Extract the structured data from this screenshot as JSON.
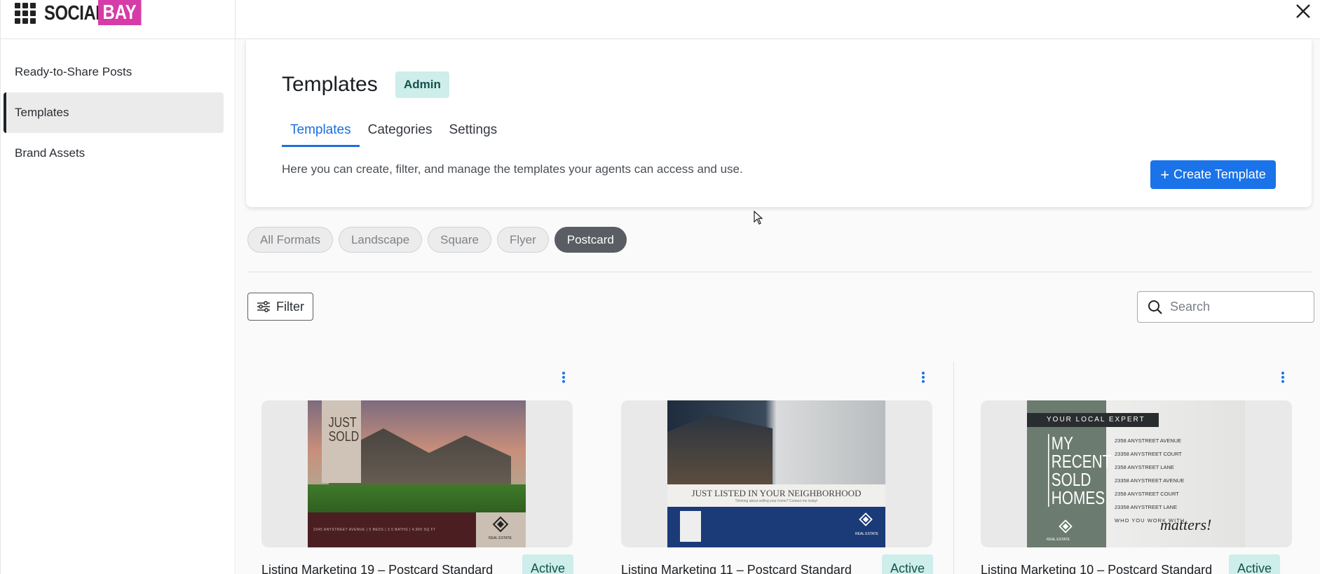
{
  "logo": {
    "part1": "SOCIAL",
    "part2": "BAY"
  },
  "sidebar": {
    "items": [
      {
        "label": "Ready-to-Share Posts"
      },
      {
        "label": "Templates"
      },
      {
        "label": "Brand Assets"
      }
    ]
  },
  "header": {
    "title": "Templates",
    "badge": "Admin",
    "tabs": [
      {
        "label": "Templates"
      },
      {
        "label": "Categories"
      },
      {
        "label": "Settings"
      }
    ],
    "description": "Here you can create, filter, and manage the templates your agents can access and use.",
    "create_label": "Create Template"
  },
  "formats": [
    "All Formats",
    "Landscape",
    "Square",
    "Flyer",
    "Postcard"
  ],
  "active_format": "Postcard",
  "filter_label": "Filter",
  "search": {
    "placeholder": "Search",
    "value": ""
  },
  "cards": [
    {
      "title": "Listing Marketing 19 – Postcard Standard",
      "status": "Active",
      "art": {
        "headline": "JUST SOLD",
        "address": "2345 ANYSTREET AVENUE   |   5 BEDS   |   3.5 BATHS   |   4,900 SQ FT",
        "brand": "REAL ESTATE"
      }
    },
    {
      "title": "Listing Marketing 11 – Postcard Standard",
      "status": "Active",
      "art": {
        "headline": "JUST LISTED IN YOUR NEIGHBORHOOD",
        "subline": "Thinking about selling your home? Contact me today!",
        "brand": "REAL ESTATE"
      }
    },
    {
      "title": "Listing Marketing 10 – Postcard Standard",
      "status": "Active",
      "art": {
        "banner": "YOUR LOCAL EXPERT",
        "headline": "MY RECENT SOLD HOMES",
        "addresses": [
          "2358 ANYSTREET AVENUE",
          "23358 ANYSTREET COURT",
          "2358 ANYSTREET LANE",
          "23358 ANYSTREET AVENUE",
          "2358 ANYSTREET COURT",
          "23358 ANYSTREET LANE"
        ],
        "tagline": "WHO YOU WORK WITH",
        "script": "matters!",
        "brand": "REAL ESTATE"
      }
    }
  ],
  "colors": {
    "accent": "#1a73e8",
    "brand_pink": "#d63ca8",
    "badge_bg": "#cdeeeb",
    "chip_active": "#5a5d63"
  },
  "icons": {
    "close": "close-icon",
    "filter": "sliders-icon",
    "search": "search-icon",
    "more": "kebab-icon"
  }
}
